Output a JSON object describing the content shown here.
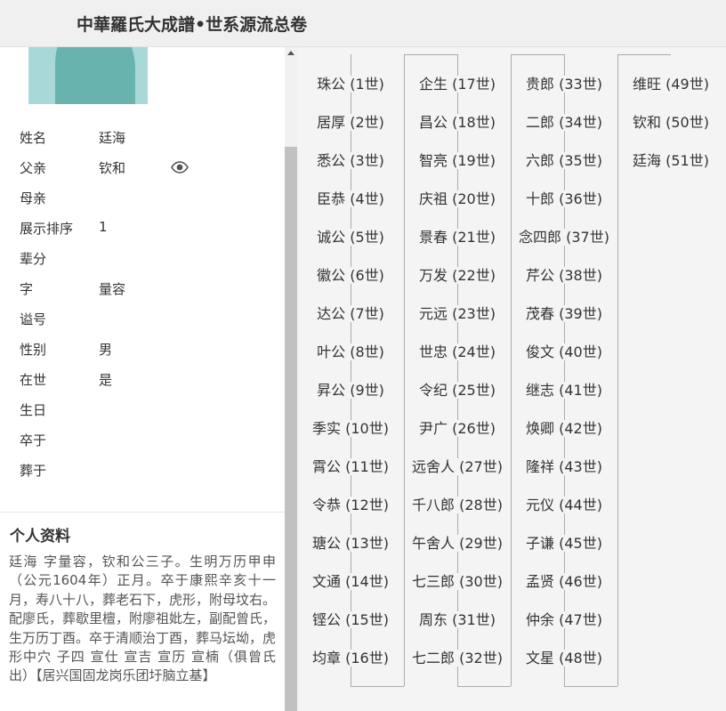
{
  "header": {
    "title": "中華羅氏大成譜•世系源流总卷"
  },
  "profile": {
    "fields": [
      {
        "label": "姓名",
        "value": "廷海"
      },
      {
        "label": "父亲",
        "value": "钦和"
      },
      {
        "label": "母亲",
        "value": ""
      },
      {
        "label": "展示排序",
        "value": "1"
      },
      {
        "label": "辈分",
        "value": ""
      },
      {
        "label": "字",
        "value": "量容"
      },
      {
        "label": "谥号",
        "value": ""
      },
      {
        "label": "性别",
        "value": "男"
      },
      {
        "label": "在世",
        "value": "是"
      },
      {
        "label": "生日",
        "value": ""
      },
      {
        "label": "卒于",
        "value": ""
      },
      {
        "label": "葬于",
        "value": ""
      }
    ]
  },
  "bio": {
    "title": "个人资料",
    "text": "廷海 字量容，钦和公三子。生明万历甲申（公元1604年）正月。卒于康熙辛亥十一月，寿八十八，葬老石下，虎形，附母坟右。配廖氏，葬歇里檀，附廖祖妣左，副配曾氏，生万历丁酉。卒于清顺治丁酉，葬马坛坳，虎形中穴 子四 宣仕 宣吉 宣历 宣楠（俱曾氏出）【居兴国固龙岗乐团圩脑立基】"
  },
  "generations": [
    [
      "珠公 (1世)",
      "居厚 (2世)",
      "悉公 (3世)",
      "臣恭 (4世)",
      "诚公 (5世)",
      "徽公 (6世)",
      "达公 (7世)",
      "叶公 (8世)",
      "昇公 (9世)",
      "季实 (10世)",
      "霄公 (11世)",
      "令恭 (12世)",
      "瑭公 (13世)",
      "文通 (14世)",
      "铿公 (15世)",
      "均章 (16世)"
    ],
    [
      "企生 (17世)",
      "昌公 (18世)",
      "智亮 (19世)",
      "庆祖 (20世)",
      "景春 (21世)",
      "万发 (22世)",
      "元远 (23世)",
      "世忠 (24世)",
      "令纪 (25世)",
      "尹广 (26世)",
      "远舍人 (27世)",
      "千八郎 (28世)",
      "午舍人 (29世)",
      "七三郎 (30世)",
      "周东 (31世)",
      "七二郎 (32世)"
    ],
    [
      "贵郎 (33世)",
      "二郎 (34世)",
      "六郎 (35世)",
      "十郎 (36世)",
      "念四郎 (37世)",
      "芹公 (38世)",
      "茂春 (39世)",
      "俊文 (40世)",
      "继志 (41世)",
      "焕卿 (42世)",
      "隆祥 (43世)",
      "元仪 (44世)",
      "子谦 (45世)",
      "孟贤 (46世)",
      "仲余 (47世)",
      "文星 (48世)"
    ],
    [
      "维旺 (49世)",
      "钦和 (50世)",
      "廷海 (51世)"
    ]
  ]
}
